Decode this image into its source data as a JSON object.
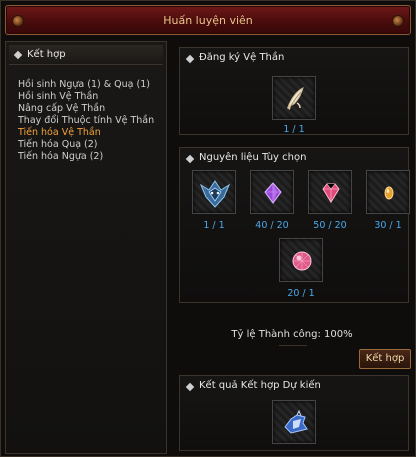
{
  "window": {
    "title": "Huấn luyện viên"
  },
  "left_panel": {
    "header": "Kết hợp",
    "items": [
      {
        "label": "Hồi sinh Ngựa (1) & Quạ (1)",
        "active": false
      },
      {
        "label": "Hồi sinh Vệ Thần",
        "active": false
      },
      {
        "label": "Nâng cấp Vệ Thần",
        "active": false
      },
      {
        "label": "Thay đổi Thuộc tính Vệ Thần",
        "active": false
      },
      {
        "label": "Tiến hóa Vệ Thần",
        "active": true
      },
      {
        "label": "Tiến hóa Quạ (2)",
        "active": false
      },
      {
        "label": "Tiến hóa Ngựa (2)",
        "active": false
      }
    ]
  },
  "register": {
    "title": "Đăng ký Vệ Thần",
    "slot": {
      "icon": "guardian-feather-icon",
      "count": "1 / 1"
    }
  },
  "materials": {
    "title": "Nguyên liệu Tùy chọn",
    "slots": [
      {
        "icon": "blue-dragon-icon",
        "count": "1 / 1"
      },
      {
        "icon": "purple-gem-icon",
        "count": "40 / 20"
      },
      {
        "icon": "pink-gem-icon",
        "count": "50 / 20"
      },
      {
        "icon": "amber-gem-icon",
        "count": "30 / 1"
      },
      {
        "icon": "pink-orb-icon",
        "count": "20 / 1"
      }
    ]
  },
  "success": {
    "label": "Tỷ lệ Thành công: 100%"
  },
  "combine_button": {
    "label": "Kết hợp"
  },
  "result": {
    "title": "Kết quả Kết hợp Dự kiến",
    "slot": {
      "icon": "blue-guardian-icon"
    }
  }
}
